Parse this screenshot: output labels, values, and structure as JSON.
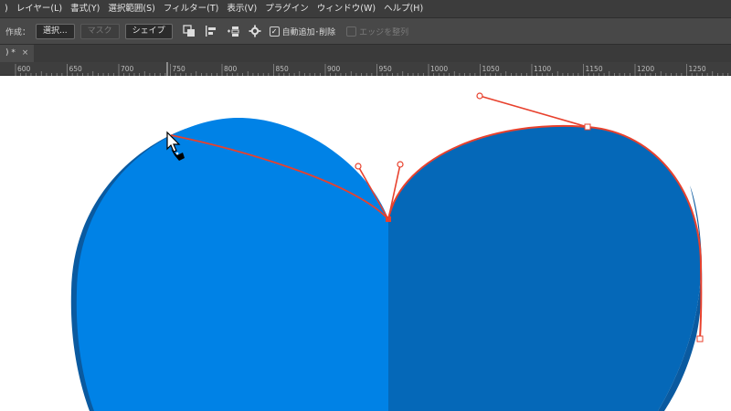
{
  "menu": {
    "items": [
      ")",
      "レイヤー(L)",
      "書式(Y)",
      "選択範囲(S)",
      "フィルター(T)",
      "表示(V)",
      "プラグイン",
      "ウィンドウ(W)",
      "ヘルプ(H)"
    ]
  },
  "options": {
    "create_label": "作成：",
    "select_button": "選択...",
    "mask_button": "マスク",
    "shape_button": "シェイプ",
    "auto_add_delete": "自動追加･削除",
    "align_edges": "エッジを整列"
  },
  "tab": {
    "title": ") *",
    "close": "×"
  },
  "ruler": {
    "ticks": [
      "600",
      "650",
      "700",
      "750",
      "800",
      "850",
      "900",
      "950",
      "1000",
      "1050",
      "1100",
      "1150",
      "1200",
      "1250"
    ]
  },
  "colors": {
    "heart_left": "#0082e6",
    "heart_right": "#0568b8",
    "heart_shadow": "#0a5aa0",
    "path_line": "#e8412d"
  },
  "icons": {
    "pen_cursor": "pen-tool-cursor"
  }
}
